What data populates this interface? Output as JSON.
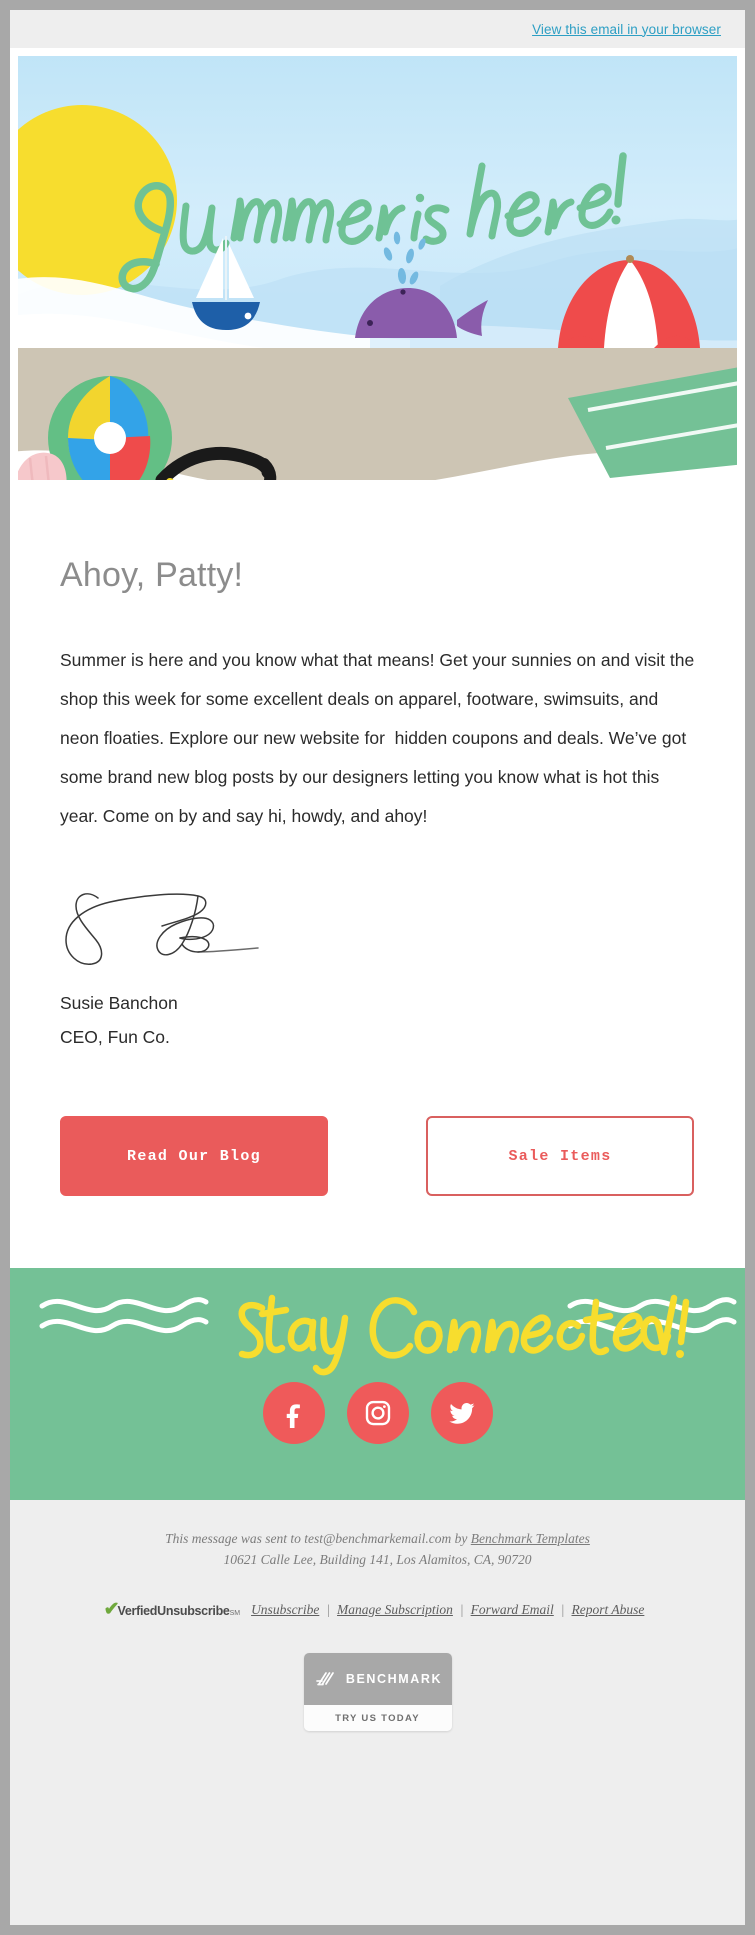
{
  "preheader": {
    "view_in_browser": "View this email in your browser"
  },
  "hero": {
    "headline": "Summer is here!",
    "alt": "Beach scene with sun, sailboat, whale, umbrella, beach ball, sunglasses, starfish and towel"
  },
  "body": {
    "greeting": "Ahoy, Patty!",
    "paragraph": "Summer is here and you know what that means! Get your sunnies on and visit the shop this week for some excellent deals on apparel, footware, swimsuits, and neon floaties. Explore our new website for  hidden coupons and deals. We’ve got some brand new blog posts by our designers letting you know what is hot this year. Come on by and say hi, howdy, and ahoy!",
    "signature_name": "Susie Banchon",
    "signature_title": "CEO, Fun Co."
  },
  "buttons": {
    "primary": "Read Our Blog",
    "secondary": "Sale Items"
  },
  "social": {
    "title": "Stay Connected!",
    "items": [
      {
        "name": "facebook",
        "label": "Facebook"
      },
      {
        "name": "instagram",
        "label": "Instagram"
      },
      {
        "name": "twitter",
        "label": "Twitter"
      }
    ]
  },
  "footer": {
    "sent_prefix": "This message was sent to test@benchmarkemail.com by ",
    "sender_link": "Benchmark Templates",
    "address": "10621 Calle Lee, Building 141, Los Alamitos, CA, 90720",
    "verified_check": "✔",
    "verified_word1": "Verfied",
    "verified_word2": "Unsubscribe",
    "verified_sm": "SM",
    "links": [
      "Unsubscribe",
      "Manage Subscription",
      "Forward Email",
      "Report Abuse"
    ],
    "separator": "|",
    "badge_brand": "BENCHMARK",
    "badge_cta": "TRY US TODAY"
  },
  "colors": {
    "accent_red": "#ea5b5b",
    "accent_green": "#74c196",
    "sand": "#cdc5b4",
    "sky": "#cfeaf8",
    "link_blue": "#2d9fc4",
    "headline_green": "#6fc295",
    "sun_yellow": "#f7dd2e"
  }
}
